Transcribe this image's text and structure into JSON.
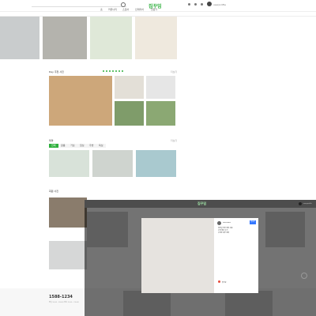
{
  "header": {
    "logo_text": "집꾸밈",
    "nav_tabs": [
      "홈",
      "커뮤니티",
      "스토어",
      "인테리어",
      "전문가"
    ],
    "user_name": "userprofile"
  },
  "sections": {
    "section1_title": "Day 추천 사진",
    "section1_more": "더보기",
    "section2_title": "테마",
    "section2_more": "더보기",
    "section3_title": "회원 사진",
    "tags": [
      "전체",
      "원룸",
      "거실",
      "침실",
      "주방",
      "욕실"
    ]
  },
  "footer": {
    "phone": "1588-1234",
    "hours": "평일 10:00 - 18:00 (점심 12:00 - 13:00)"
  },
  "modal": {
    "author": "username",
    "follow_label": "팔로우",
    "description_lines": [
      "화장실 선반 정리 완료",
      "",
      "수납 정리 후기",
      "수납장 내부 정리"
    ],
    "like_label": "좋아요"
  },
  "colors": {
    "brand": "#2eaf3c",
    "overlay": "#000000",
    "follow_button": "#3377ff"
  }
}
